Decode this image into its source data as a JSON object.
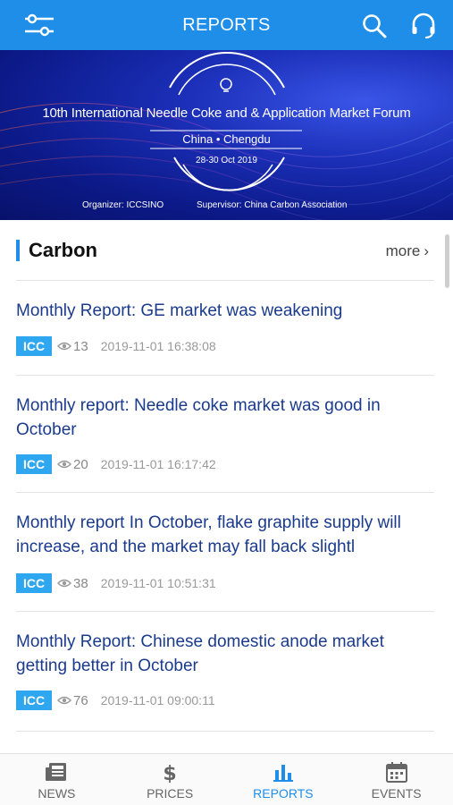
{
  "header": {
    "title": "REPORTS",
    "icons": {
      "filter": "filter-sliders-icon",
      "search": "search-icon",
      "support": "headset-icon"
    },
    "bg_color": "#1e8ee8"
  },
  "banner": {
    "title": "10th International Needle Coke and & Application Market Forum",
    "location": "China • Chengdu",
    "dates": "28-30 Oct 2019",
    "organizer": "Organizer: ICCSINO",
    "supervisor": "Supervisor: China Carbon Association"
  },
  "section": {
    "title": "Carbon",
    "more_label": "more",
    "accent_color": "#1e8ee8"
  },
  "articles": [
    {
      "title": "Monthly Report: GE market was weakening",
      "tag": "ICC",
      "views": "13",
      "datetime": "2019-11-01 16:38:08"
    },
    {
      "title": "Monthly report: Needle coke market was good in October",
      "tag": "ICC",
      "views": "20",
      "datetime": "2019-11-01 16:17:42"
    },
    {
      "title": "Monthly report In October, flake graphite supply will increase, and the market may fall back slightl",
      "tag": "ICC",
      "views": "38",
      "datetime": "2019-11-01 10:51:31"
    },
    {
      "title": "Monthly Report: Chinese domestic anode market getting better in October",
      "tag": "ICC",
      "views": "76",
      "datetime": "2019-11-01 09:00:11"
    }
  ],
  "nav": [
    {
      "label": "NEWS",
      "icon": "newspaper-icon",
      "active": false
    },
    {
      "label": "PRICES",
      "icon": "dollar-icon",
      "active": false
    },
    {
      "label": "REPORTS",
      "icon": "bar-chart-icon",
      "active": true
    },
    {
      "label": "EVENTS",
      "icon": "calendar-icon",
      "active": false
    }
  ],
  "colors": {
    "tag": "#2ea6f0",
    "headline": "#1a3a8c",
    "active_nav": "#1e8ee8"
  }
}
